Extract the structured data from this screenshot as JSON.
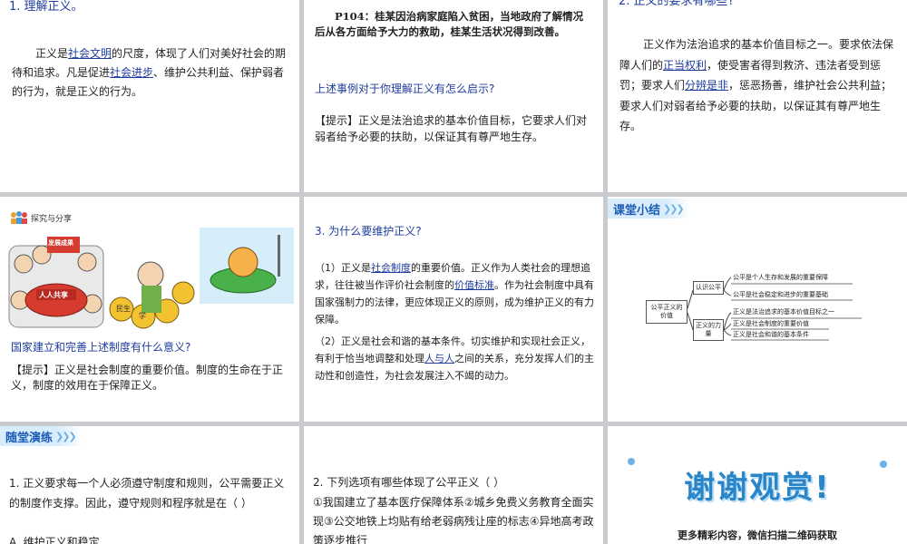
{
  "s1": {
    "heading": "1. 理解正义。",
    "t1": "正义是",
    "link1": "社会文明",
    "t2": "的尺度，体现了人们对美好社会的期待和追求。凡是促进",
    "link2": "社会进步",
    "t3": "、维护公共利益、保护弱者的行为，就是正义的行为。"
  },
  "s2": {
    "case": "P104：桂某因治病家庭陷入贫困，当地政府了解情况后从各方面给予大力的救助，桂某生活状况得到改善。",
    "question": "上述事例对于你理解正义有怎么启示?",
    "tip_label": "【提示】",
    "tip_text": "正义是法治追求的基本价值目标，它要求人们对弱者给予必要的扶助，以保证其有尊严地生存。"
  },
  "s3": {
    "heading": "2. 正义的要求有哪些?",
    "t1": "正义作为法治追求的基本价值目标之一。要求依法保障人们的",
    "link1": "正当权利",
    "t2": "，使受害者得到救济、违法者受到惩罚；要求人们",
    "link2": "分辨是非",
    "t3": "，惩恶扬善，维护社会公共利益；要求人们对弱者给予必要的扶助，以保证其有尊严地生存。"
  },
  "s4": {
    "label": "探究与分享",
    "img_text1": "发展成果",
    "img_text2": "人人共享",
    "img_text3": "民生",
    "img_text4": "学",
    "question": "国家建立和完善上述制度有什么意义?",
    "tip_label": "【提示】",
    "tip_text": "正义是社会制度的重要价值。制度的生命在于正义，制度的效用在于保障正义。"
  },
  "s5": {
    "heading": "3. 为什么要维护正义?",
    "p1a": "（1）正义是",
    "p1link": "社会制度",
    "p1b": "的重要价值。正义作为人类社会的理想追求，往往被当作评价社会制度的",
    "p1link2": "价值标准",
    "p1c": "。作为社会制度中具有国家强制力的法律，更应体现正义的原则，成为维护正义的有力保障。",
    "p2a": "（2）正义是社会和谐的基本条件。切实维护和实现社会正义，有利于恰当地调整和处理",
    "p2link": "人与人",
    "p2b": "之间的关系，充分发挥人们的主动性和创造性，为社会发展注入不竭的动力。"
  },
  "s6": {
    "badge": "课堂小结",
    "root": "公平正义的价值",
    "branch1": "认识公平",
    "branch2": "正义的力量",
    "leaf1": "公平是个人生存和发展的重要保障",
    "leaf2": "公平是社会稳定和进步的重要基础",
    "leaf3": "正义是法治追求的基本价值目标之一",
    "leaf4": "正义是社会制度的重要价值",
    "leaf5": "正义是社会和谐的基本条件"
  },
  "s7": {
    "badge": "随堂演练",
    "q": "1. 正义要求每一个人必须遵守制度和规则，公平需要正义的制度作支撑。因此，遵守规则和程序就是在（    ）",
    "optA": "A. 维护正义和稳定"
  },
  "s8": {
    "q": "2. 下列选项有哪些体现了公平正义（    ）",
    "opts": "①我国建立了基本医疗保障体系②城乡免费义务教育全面实现③公交地铁上均贴有给老弱病残让座的标志④异地高考政策逐步推行"
  },
  "s9": {
    "title": "谢谢观赏!",
    "subtitle": "更多精彩内容，微信扫描二维码获取"
  },
  "colors": {
    "accent": "#1f3d9e",
    "badge": "#d9ecfb",
    "thanks": "#2a86c9"
  }
}
